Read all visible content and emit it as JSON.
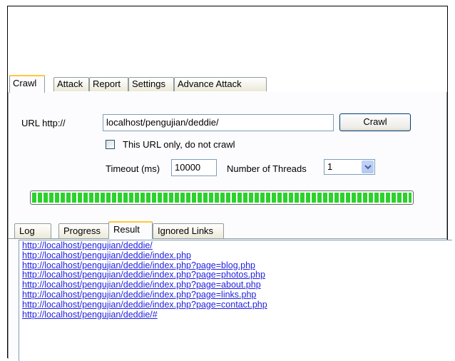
{
  "main_tabs": [
    {
      "label": "Crawl",
      "active": true
    },
    {
      "label": "Attack",
      "active": false
    },
    {
      "label": "Report",
      "active": false
    },
    {
      "label": "Settings",
      "active": false
    },
    {
      "label": "Advance Attack",
      "active": false
    }
  ],
  "crawl": {
    "url_label": "URL http://",
    "url_value": "localhost/pengujian/deddie/",
    "crawl_button": "Crawl",
    "url_only_label": "This URL only, do not crawl",
    "url_only_checked": false,
    "timeout_label": "Timeout (ms)",
    "timeout_value": "10000",
    "threads_label": "Number of Threads",
    "threads_value": "1",
    "progress_fraction": 1.0
  },
  "sub_tabs": [
    {
      "label": "Log",
      "active": false
    },
    {
      "label": "Progress",
      "active": false
    },
    {
      "label": "Result",
      "active": true
    },
    {
      "label": "Ignored Links",
      "active": false
    }
  ],
  "results": [
    "http://localhost/pengujian/deddie/",
    "http://localhost/pengujian/deddie/index.php",
    "http://localhost/pengujian/deddie/index.php?page=blog.php",
    "http://localhost/pengujian/deddie/index.php?page=photos.php",
    "http://localhost/pengujian/deddie/index.php?page=about.php",
    "http://localhost/pengujian/deddie/index.php?page=links.php",
    "http://localhost/pengujian/deddie/index.php?page=contact.php",
    "http://localhost/pengujian/deddie/#"
  ],
  "colors": {
    "link": "#1f1fe0",
    "progress_fill": "#2bd22b",
    "active_tab_accent": "#ffc83c"
  }
}
